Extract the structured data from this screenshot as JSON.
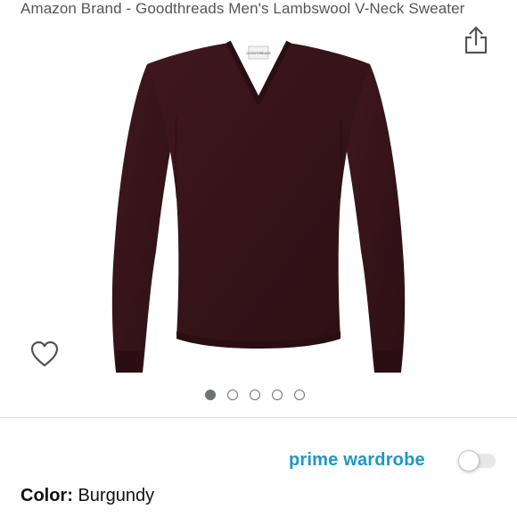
{
  "product": {
    "title": "Amazon Brand - Goodthreads Men's Lambswool V-Neck Sweater",
    "image_alt": "burgundy v-neck sweater",
    "sweater_color": "#3b1620",
    "brand_tag": "GOODTHREADS"
  },
  "actions": {
    "share_icon": "share-icon",
    "wishlist_icon": "heart-outline-icon"
  },
  "carousel": {
    "total": 5,
    "active_index": 0
  },
  "prime_wardrobe": {
    "label": "prime wardrobe",
    "enabled": false,
    "accent_color": "#1e96c8"
  },
  "selection": {
    "color_label": "Color:",
    "color_value": "Burgundy"
  }
}
